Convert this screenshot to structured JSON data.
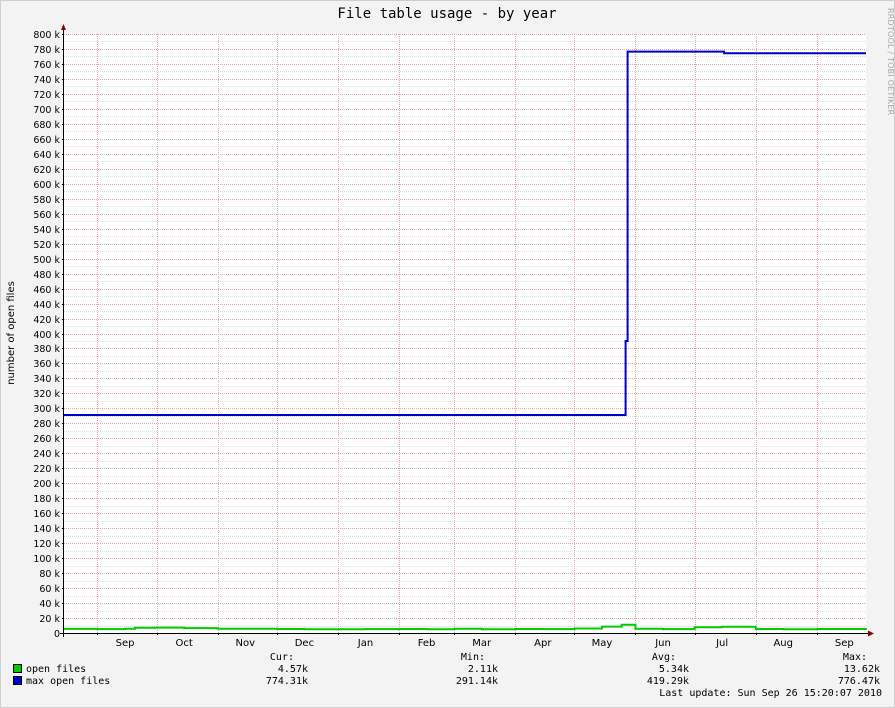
{
  "chart_data": {
    "type": "line",
    "title": "File table usage - by year",
    "ylabel": "number of open files",
    "xlabel": "",
    "ylim": [
      0,
      800000
    ],
    "yticks": [
      "0",
      "20 k",
      "40 k",
      "60 k",
      "80 k",
      "100 k",
      "120 k",
      "140 k",
      "160 k",
      "180 k",
      "200 k",
      "220 k",
      "240 k",
      "260 k",
      "280 k",
      "300 k",
      "320 k",
      "340 k",
      "360 k",
      "380 k",
      "400 k",
      "420 k",
      "440 k",
      "460 k",
      "480 k",
      "500 k",
      "520 k",
      "540 k",
      "560 k",
      "580 k",
      "600 k",
      "620 k",
      "640 k",
      "660 k",
      "680 k",
      "700 k",
      "720 k",
      "740 k",
      "760 k",
      "780 k",
      "800 k"
    ],
    "xticks": [
      "Sep",
      "Oct",
      "Nov",
      "Dec",
      "Jan",
      "Feb",
      "Mar",
      "Apr",
      "May",
      "Jun",
      "Jul",
      "Aug",
      "Sep"
    ],
    "xlim": [
      "2009-08-15",
      "2010-09-26"
    ],
    "series": [
      {
        "name": "open files",
        "color": "#00cc00",
        "x": [
          "2009-08-15",
          "2009-09-01",
          "2009-09-15",
          "2009-09-20",
          "2009-10-01",
          "2009-10-15",
          "2009-11-01",
          "2009-11-15",
          "2009-12-01",
          "2009-12-15",
          "2010-01-01",
          "2010-01-15",
          "2010-02-01",
          "2010-02-15",
          "2010-03-01",
          "2010-03-15",
          "2010-04-01",
          "2010-04-15",
          "2010-05-01",
          "2010-05-15",
          "2010-05-25",
          "2010-06-01",
          "2010-06-15",
          "2010-07-01",
          "2010-07-15",
          "2010-08-01",
          "2010-08-15",
          "2010-09-01",
          "2010-09-26"
        ],
        "y": [
          5500,
          5200,
          5600,
          7000,
          7200,
          6500,
          5600,
          5800,
          5300,
          5000,
          4900,
          5200,
          5400,
          5000,
          5600,
          5100,
          5300,
          5200,
          6000,
          8500,
          11000,
          5800,
          5200,
          7600,
          8300,
          5300,
          5000,
          5400,
          4570
        ]
      },
      {
        "name": "max open files",
        "color": "#0000cc",
        "x": [
          "2009-08-15",
          "2010-05-26",
          "2010-05-27",
          "2010-05-28",
          "2010-07-16",
          "2010-09-26"
        ],
        "y": [
          291140,
          291140,
          390000,
          776470,
          774310,
          774310
        ]
      }
    ],
    "legend": {
      "headers": [
        "Cur:",
        "Min:",
        "Avg:",
        "Max:"
      ],
      "rows": [
        {
          "name": "open files",
          "color": "#00cc00",
          "cur": "4.57k",
          "min": "2.11k",
          "avg": "5.34k",
          "max": "13.62k"
        },
        {
          "name": "max open files",
          "color": "#0000cc",
          "cur": "774.31k",
          "min": "291.14k",
          "avg": "419.29k",
          "max": "776.47k"
        }
      ]
    },
    "grid": true
  },
  "footer": {
    "last_update": "Last update: Sun Sep 26 15:20:07 2010"
  },
  "watermark": "RRDTOOL / TOBI OETIKER"
}
